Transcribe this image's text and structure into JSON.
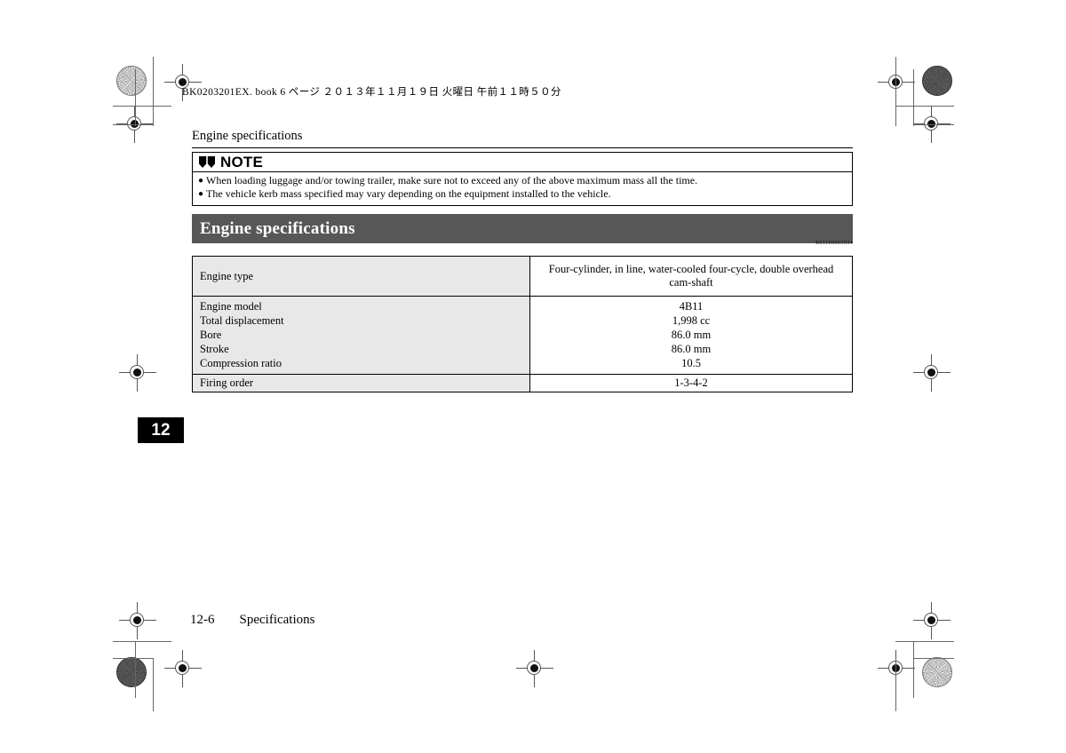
{
  "document": {
    "print_header": "BK0203201EX. book   6 ページ   ２０１３年１１月１９日   火曜日   午前１１時５０分",
    "section_label": "Engine specifications",
    "reference_code": "E01100603934",
    "page_tab": "12",
    "footer": {
      "page_number": "12-6",
      "chapter": "Specifications"
    }
  },
  "note": {
    "icon": "open-book-icon",
    "title": "NOTE",
    "bullet": "●",
    "items": [
      "When loading luggage and/or towing trailer, make sure not to exceed any of the above maximum mass all the time.",
      "The vehicle kerb mass specified may vary depending on the equipment installed to the vehicle."
    ]
  },
  "title_bar": {
    "text": "Engine specifications",
    "background": "#575757",
    "color": "#ffffff"
  },
  "spec_table": {
    "row_engine_type": {
      "label": "Engine type",
      "value": "Four-cylinder, in line, water-cooled four-cycle, double overhead cam-shaft"
    },
    "group_rows": {
      "labels": [
        "Engine model",
        "Total displacement",
        "Bore",
        "Stroke",
        "Compression ratio"
      ],
      "values": [
        "4B11",
        "1,998 cc",
        "86.0 mm",
        "86.0 mm",
        "10.5"
      ]
    },
    "row_firing_order": {
      "label": "Firing order",
      "value": "1-3-4-2"
    }
  }
}
